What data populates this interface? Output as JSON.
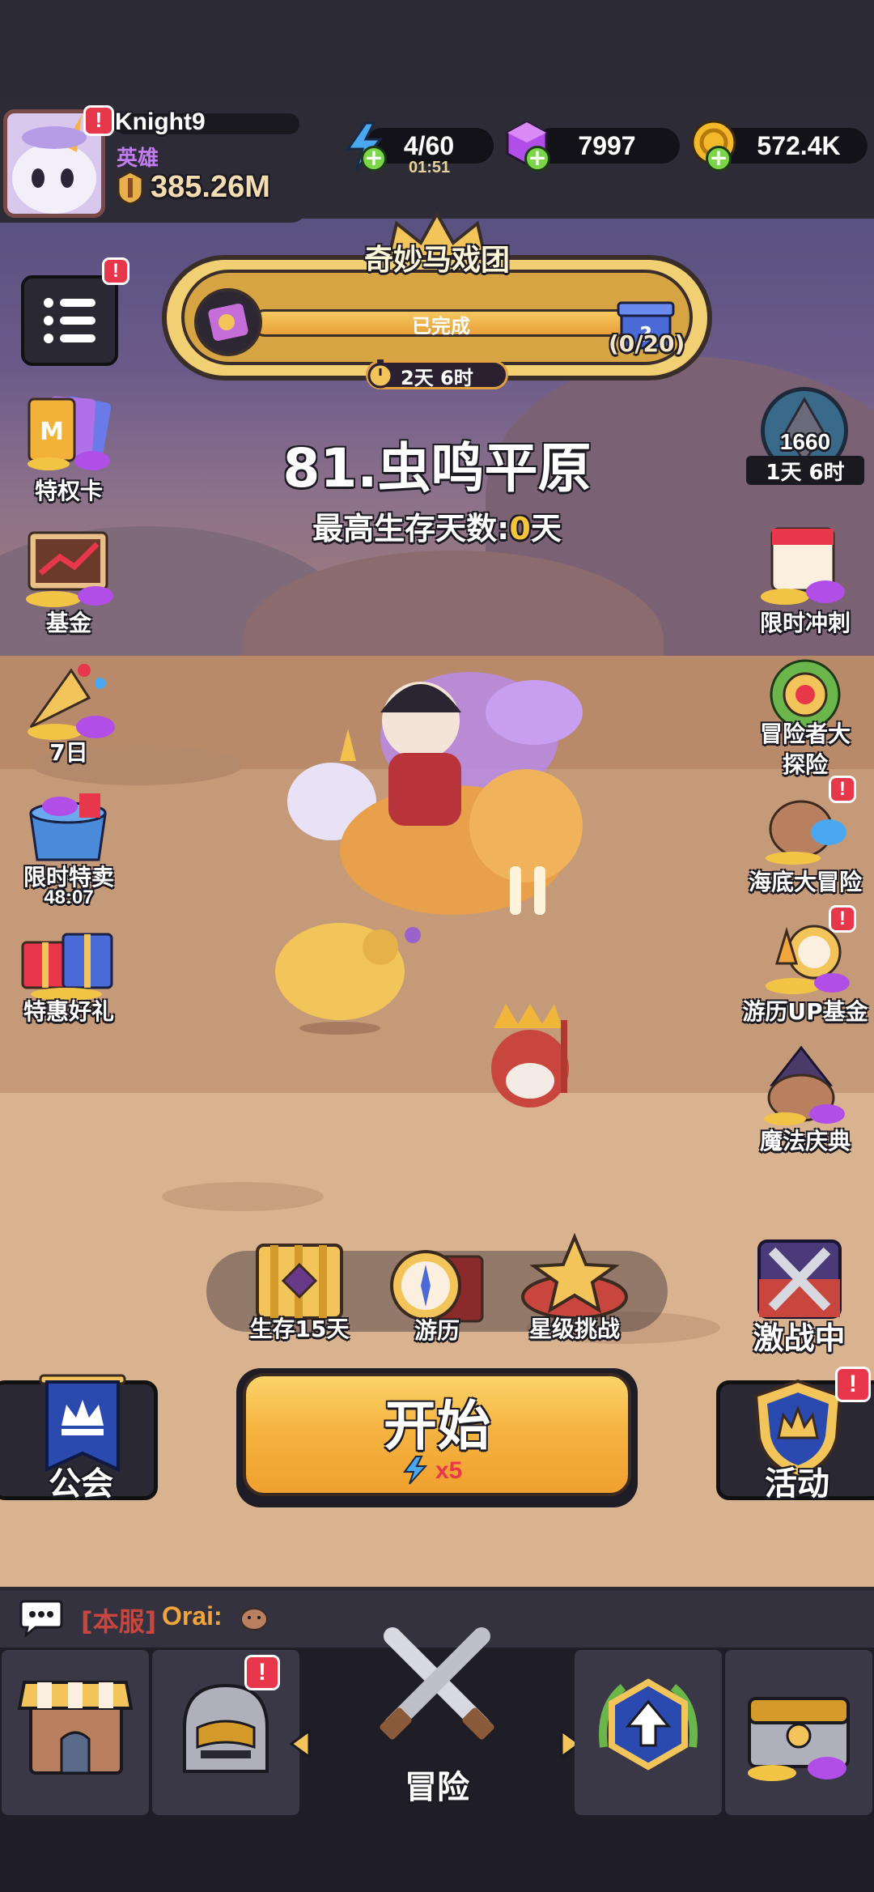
{
  "player": {
    "name": "Knight9",
    "rank": "英雄",
    "power": "385.26M"
  },
  "resources": {
    "energy": "4/60",
    "energy_timer": "01:51",
    "gems": "7997",
    "gold": "572.4K"
  },
  "event": {
    "title": "奇妙马戏团",
    "status": "已完成",
    "progress": "(0/20)",
    "time_left": "2天 6时",
    "progress_fraction": 1.0
  },
  "stage": {
    "name": "81.虫鸣平原",
    "best_prefix": "最高生存天数:",
    "best_value": "0",
    "best_suffix": "天"
  },
  "left_menu": [
    {
      "label": "特权卡"
    },
    {
      "label": "基金"
    },
    {
      "label": "7日"
    },
    {
      "label": "限时特卖",
      "timer": "48:07"
    },
    {
      "label": "特惠好礼"
    }
  ],
  "right_menu": {
    "rank_value": "1660",
    "rank_time": "1天 6时",
    "items": [
      {
        "label": "限时冲刺"
      },
      {
        "label": "冒险者大\n探险"
      },
      {
        "label": "海底大冒险"
      },
      {
        "label": "游历UP基金"
      },
      {
        "label": "魔法庆典"
      }
    ]
  },
  "modes": [
    {
      "label": "生存15天"
    },
    {
      "label": "游历"
    },
    {
      "label": "星级挑战"
    }
  ],
  "battle": {
    "label": "激战中"
  },
  "guild": {
    "label": "公会"
  },
  "activity": {
    "label": "活动"
  },
  "start": {
    "label": "开始",
    "cost": "x5"
  },
  "chat": {
    "channel": "[本服]",
    "sender": "Orai:"
  },
  "nav": {
    "center_label": "冒险"
  },
  "colors": {
    "accent": "#f2a53a",
    "badge": "#e8364a",
    "purple": "#b070e8",
    "dark": "#2d2b36"
  }
}
